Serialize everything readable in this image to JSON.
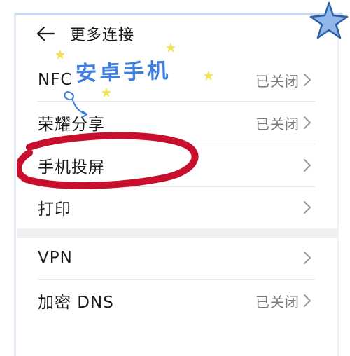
{
  "header": {
    "title": "更多连接",
    "back_icon": "arrow-left-icon"
  },
  "watermark": "安卓手机",
  "settings": [
    {
      "label": "NFC",
      "value": "已关闭"
    },
    {
      "label": "荣耀分享",
      "value": "已关闭"
    },
    {
      "label": "手机投屏",
      "value": ""
    },
    {
      "label": "打印",
      "value": ""
    },
    {
      "label": "VPN",
      "value": ""
    },
    {
      "label": "加密 DNS",
      "value": "已关闭"
    }
  ],
  "colors": {
    "text": "#1a1a1a",
    "value_text": "#7a7a7a",
    "annotation_circle": "#c8102e",
    "watermark": "#3e7fe0",
    "star": "#f2e35a",
    "big_star": "#8fb7ea"
  }
}
